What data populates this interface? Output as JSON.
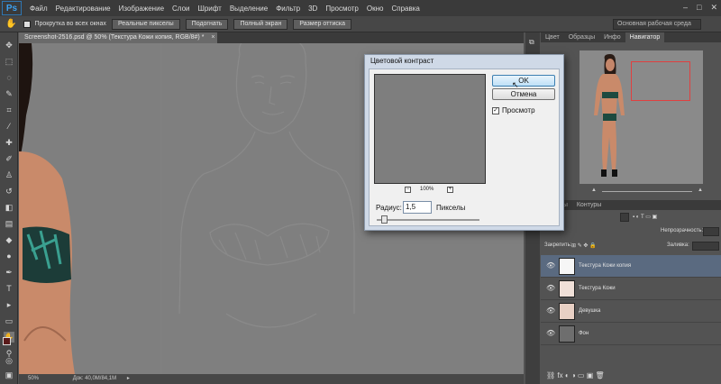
{
  "app": {
    "logo": "Ps",
    "menu": [
      "Файл",
      "Редактирование",
      "Изображение",
      "Слои",
      "Шрифт",
      "Выделение",
      "Фильтр",
      "3D",
      "Просмотр",
      "Окно",
      "Справка"
    ],
    "window_controls": [
      "–",
      "□",
      "✕"
    ]
  },
  "options": {
    "scroll_all_label": "Прокрутка во всех окнах",
    "buttons": [
      "Реальные пикселы",
      "Подогнать",
      "Полный экран",
      "Размер оттиска"
    ],
    "workspace": "Основная рабочая среда"
  },
  "document": {
    "tab_title": "Screenshot-2516.psd @ 50% (Текстура Кожи копия, RGB/8#) *",
    "zoom": "50%",
    "doc_size": "Док: 40,0M/84,1M"
  },
  "navigator": {
    "tabs": [
      "Цвет",
      "Образцы",
      "Инфо",
      "Навигатор"
    ],
    "active_tab": "Навигатор"
  },
  "layers": {
    "tabs": [
      "Каналы",
      "Контуры"
    ],
    "opacity_label": "Непрозрачность:",
    "lock_label": "Закрепить:",
    "fill_label": "Заливка:",
    "items": [
      {
        "name": "Текстура Кожи копия",
        "active": true
      },
      {
        "name": "Текстура Кожи",
        "active": false
      },
      {
        "name": "Девушка",
        "active": false
      },
      {
        "name": "Фон",
        "active": false
      }
    ]
  },
  "dialog": {
    "title": "Цветовой контраст",
    "ok": "OK",
    "cancel": "Отмена",
    "preview_label": "Просмотр",
    "preview_checked": true,
    "zoom_level": "100%",
    "zoom_out": "−",
    "zoom_in": "+",
    "radius_label": "Радиус:",
    "radius_value": "1,5",
    "radius_unit": "Пикселы"
  }
}
